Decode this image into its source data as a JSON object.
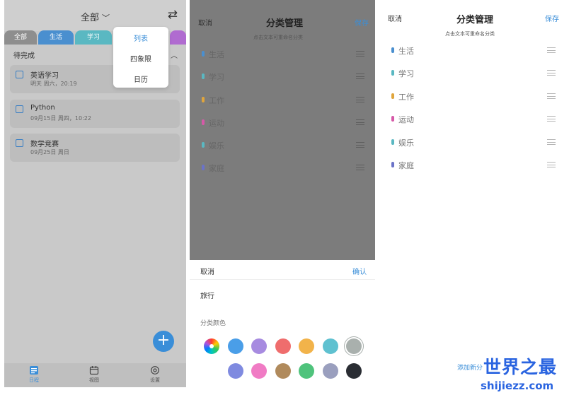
{
  "screen1": {
    "header": {
      "title": "全部",
      "title_chevron": "chevron-down-icon",
      "swap_icon": "swap-arrows-icon"
    },
    "tabs": [
      "全部",
      "生活",
      "学习"
    ],
    "dropdown": [
      {
        "label": "列表",
        "active": true
      },
      {
        "label": "四象限",
        "active": false
      },
      {
        "label": "日历",
        "active": false
      }
    ],
    "section_title": "待完成",
    "tasks": [
      {
        "name": "英语学习",
        "date": "明天 周六，20:19"
      },
      {
        "name": "Python",
        "date": "09月15日 周四，10:22"
      },
      {
        "name": "数学竞赛",
        "date": "09月25日 周日"
      }
    ],
    "fab_icon": "plus-icon",
    "bottom_nav": [
      {
        "label": "日程",
        "icon": "list-grid-icon",
        "active": true
      },
      {
        "label": "视图",
        "icon": "calendar-icon",
        "active": false
      },
      {
        "label": "设置",
        "icon": "settings-icon",
        "active": false
      }
    ]
  },
  "screen2": {
    "cancel": "取消",
    "title": "分类管理",
    "save": "保存",
    "hint": "点击文本可重命名分类",
    "categories": [
      {
        "name": "生活",
        "color": "#4a8fcf"
      },
      {
        "name": "学习",
        "color": "#5ab8c2"
      },
      {
        "name": "工作",
        "color": "#e0a53c"
      },
      {
        "name": "运动",
        "color": "#d659a8"
      },
      {
        "name": "娱乐",
        "color": "#5ab8c2"
      },
      {
        "name": "家庭",
        "color": "#6b73c8"
      }
    ],
    "sheet": {
      "cancel": "取消",
      "confirm": "确认",
      "name_value": "旅行",
      "color_label": "分类颜色",
      "colors_row1": [
        "#4a9ee8",
        "#a78be0",
        "#ef6d6d",
        "#f2b34a",
        "#5fc1d0",
        "#a9b0ad"
      ],
      "colors_row2": [
        "#7f8ae0",
        "#f07bc4",
        "#b08a5c",
        "#4fc37c",
        "#9a9fbe",
        "#2a2d33"
      ]
    }
  },
  "screen3": {
    "cancel": "取消",
    "title": "分类管理",
    "save": "保存",
    "hint": "点击文本可重命名分类",
    "categories": [
      {
        "name": "生活",
        "color": "#4a8fcf"
      },
      {
        "name": "学习",
        "color": "#5ab8c2"
      },
      {
        "name": "工作",
        "color": "#e0a53c"
      },
      {
        "name": "运动",
        "color": "#d659a8"
      },
      {
        "name": "娱乐",
        "color": "#5ab8c2"
      },
      {
        "name": "家庭",
        "color": "#6b73c8"
      }
    ],
    "add_link": "添加新分"
  },
  "watermark": {
    "top": "世界之最",
    "bottom": "shijiezz.com"
  }
}
